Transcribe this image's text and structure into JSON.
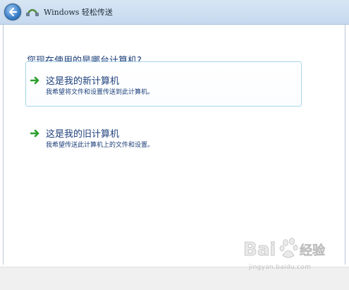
{
  "window": {
    "title": "Windows 轻松传送"
  },
  "page": {
    "question": "您现在使用的是哪台计算机?"
  },
  "options": [
    {
      "title": "这是我的新计算机",
      "description": "我希望将文件和设置传送到此计算机。",
      "selected": true
    },
    {
      "title": "这是我的旧计算机",
      "description": "我希望传送此计算机上的文件和设置。",
      "selected": false
    }
  ],
  "watermark": {
    "brand": "Bai经验",
    "url": "jingyan.baidu.com"
  },
  "colors": {
    "text_blue": "#1d3f7a",
    "arrow_green": "#2e9e2e",
    "select_border": "#a7d4ec"
  },
  "icons": {
    "back": "back-arrow-icon",
    "app": "transfer-cable-icon",
    "option": "green-arrow-icon"
  }
}
